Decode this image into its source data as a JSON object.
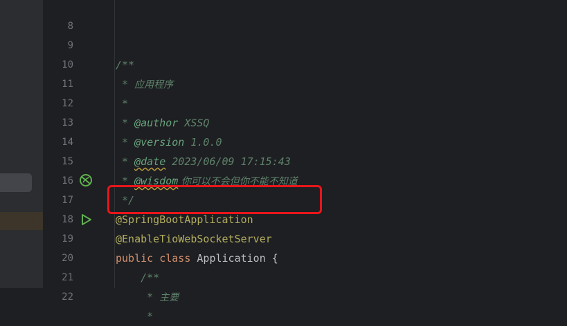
{
  "editor": {
    "lines": [
      {
        "num": "8"
      },
      {
        "num": "9",
        "open": "/**"
      },
      {
        "num": "10",
        "star": " * ",
        "text": "应用程序"
      },
      {
        "num": "11",
        "star": " *"
      },
      {
        "num": "12",
        "star": " * ",
        "tag": "@author",
        "value": " XSSQ"
      },
      {
        "num": "13",
        "star": " * ",
        "tag": "@version",
        "value": " 1.0.0"
      },
      {
        "num": "14",
        "star": " * ",
        "tag": "@date",
        "value": " 2023/06/09 17:15:43"
      },
      {
        "num": "15",
        "star": " * ",
        "tag": "@wisdom",
        "value": " 你可以不会但你不能不知道"
      },
      {
        "num": "16",
        "close": " */"
      },
      {
        "num": "17",
        "annotation": "@SpringBootApplication"
      },
      {
        "num": "18",
        "annotation": "@EnableTioWebSocketServer"
      },
      {
        "num": "19",
        "kw1": "public",
        "kw2": "class",
        "name": "Application",
        "brace": "{"
      },
      {
        "num": "20",
        "open": "    /**"
      },
      {
        "num": "21",
        "star": "     * ",
        "text": "主要"
      },
      {
        "num": "22",
        "star": "     *"
      }
    ]
  },
  "gutter_icons": {
    "spring_bean": "spring-bean-icon",
    "run": "run-icon"
  },
  "colors": {
    "background": "#1e1f22",
    "doc_comment": "#5f826b",
    "doc_tag": "#67a37c",
    "annotation": "#b3ae60",
    "keyword": "#cf8e6d",
    "highlight_box": "#e8161b"
  }
}
